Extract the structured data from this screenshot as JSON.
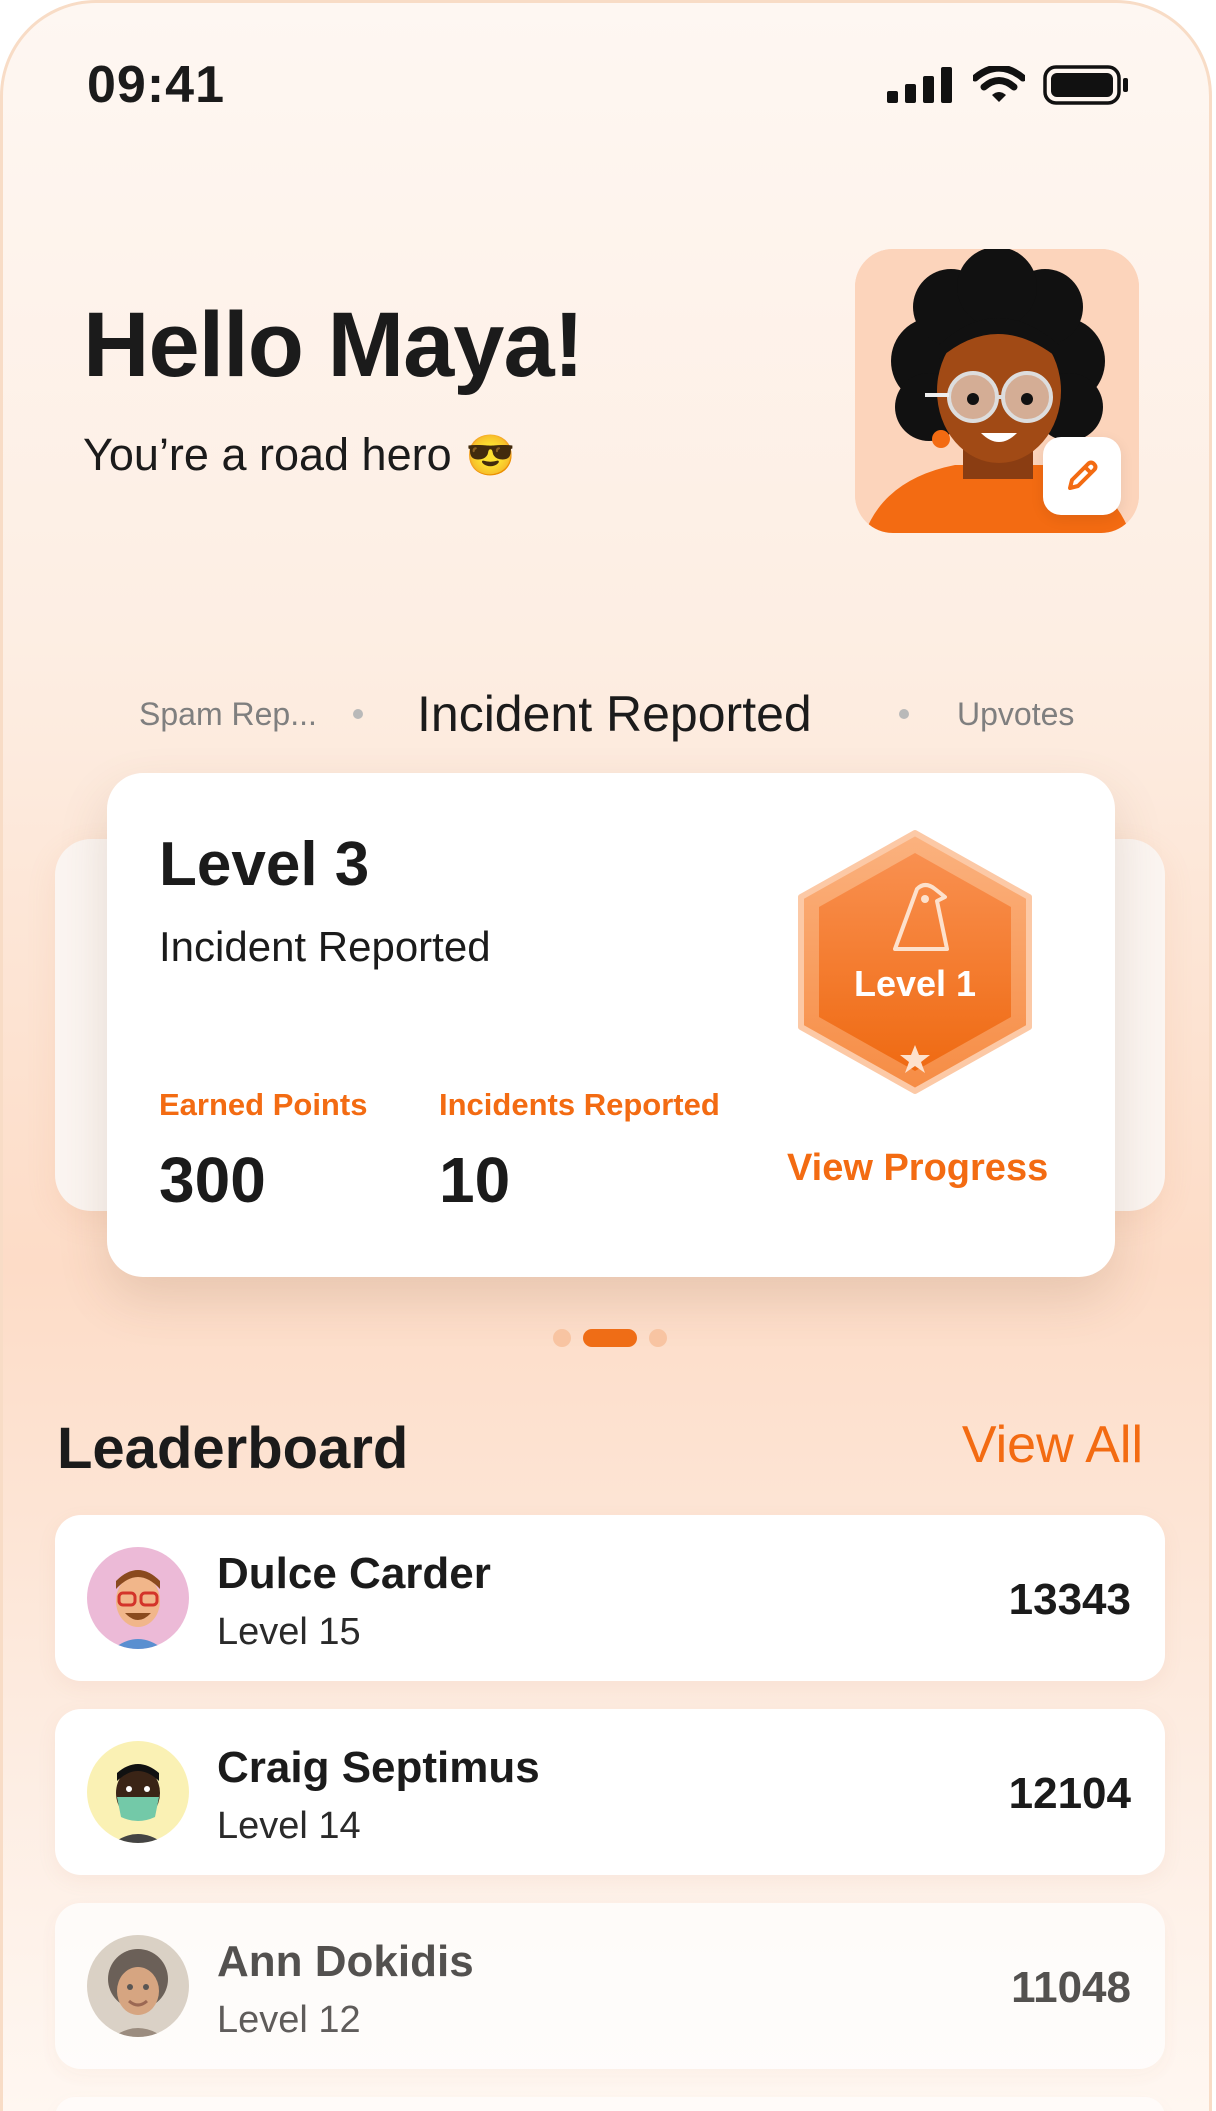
{
  "status_bar": {
    "time": "09:41",
    "icons": [
      "signal-icon",
      "wifi-icon",
      "battery-icon"
    ]
  },
  "greeting": {
    "title": "Hello Maya!",
    "subtitle": "You’re a road hero",
    "emoji": "😎"
  },
  "profile": {
    "avatar_icon": "user-avatar",
    "edit_icon": "pencil-icon"
  },
  "tabs": [
    {
      "label": "Spam Rep..."
    },
    {
      "label": "Incident Reported"
    },
    {
      "label": "Upvotes"
    }
  ],
  "achievement_card": {
    "level": "Level 3",
    "category": "Incident Reported",
    "earned_points_label": "Earned Points",
    "earned_points_value": "300",
    "incidents_label": "Incidents Reported",
    "incidents_value": "10",
    "badge_label": "Level 1",
    "view_progress_label": "View Progress"
  },
  "pager": {
    "count": 3,
    "active_index": 1
  },
  "leaderboard": {
    "title": "Leaderboard",
    "view_all_label": "View All",
    "entries": [
      {
        "name": "Dulce Carder",
        "level": "Level 15",
        "score": "13343",
        "avatar_bg": "#ecbad7"
      },
      {
        "name": "Craig Septimus",
        "level": "Level 14",
        "score": "12104",
        "avatar_bg": "#faf1b4"
      },
      {
        "name": "Ann Dokidis",
        "level": "Level 12",
        "score": "11048",
        "avatar_bg": "#cfc6b9"
      }
    ]
  },
  "colors": {
    "accent": "#f36b12",
    "background": "#fdeee3",
    "card": "#ffffff"
  }
}
